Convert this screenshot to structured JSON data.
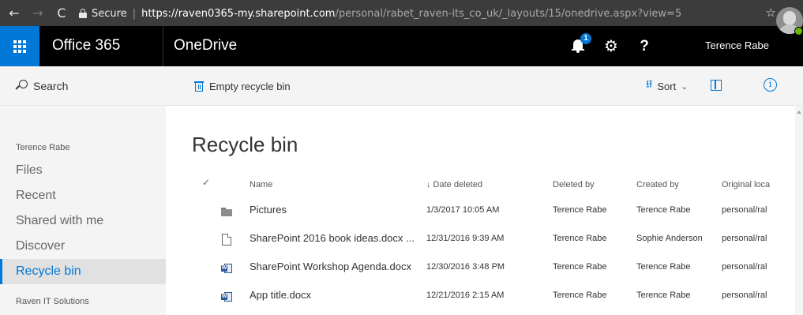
{
  "browser": {
    "back": "←",
    "forward": "→",
    "reload": "C",
    "secure_label": "Secure",
    "separator": "|",
    "url_scheme": "https://",
    "url_host": "raven0365-my.sharepoint.com",
    "url_path": "/personal/rabet_raven-its_co_uk/_layouts/15/onedrive.aspx?view=5",
    "bookmark": "☆",
    "menu": "⋮"
  },
  "suite": {
    "product": "Office 365",
    "app": "OneDrive",
    "notification_count": "1",
    "settings_glyph": "⚙",
    "help_glyph": "?",
    "user_name": "Terence Rabe"
  },
  "nav": {
    "search_label": "Search",
    "group_title": "Terence Rabe",
    "items": [
      {
        "label": "Files"
      },
      {
        "label": "Recent"
      },
      {
        "label": "Shared with me"
      },
      {
        "label": "Discover"
      },
      {
        "label": "Recycle bin",
        "selected": true
      }
    ],
    "group2_title": "Raven IT Solutions"
  },
  "commandbar": {
    "empty_bin_label": "Empty recycle bin",
    "sort_glyph": "⭿",
    "sort_label": "Sort",
    "sort_chevron": "⌄",
    "info_glyph": "i"
  },
  "main": {
    "title": "Recycle bin",
    "check_glyph": "✓",
    "columns": {
      "name": "Name",
      "date_deleted": "↓ Date deleted",
      "deleted_by": "Deleted by",
      "created_by": "Created by",
      "original_location": "Original loca"
    },
    "rows": [
      {
        "icon": "folder-icon",
        "name": "Pictures",
        "date_deleted": "1/3/2017 10:05 AM",
        "deleted_by": "Terence Rabe",
        "created_by": "Terence Rabe",
        "original_location": "personal/ral"
      },
      {
        "icon": "document-icon",
        "name": "SharePoint 2016 book ideas.docx ...",
        "date_deleted": "12/31/2016 9:39 AM",
        "deleted_by": "Terence Rabe",
        "created_by": "Sophie Anderson",
        "original_location": "personal/ral"
      },
      {
        "icon": "word-document-icon",
        "name": "SharePoint Workshop Agenda.docx",
        "date_deleted": "12/30/2016 3:48 PM",
        "deleted_by": "Terence Rabe",
        "created_by": "Terence Rabe",
        "original_location": "personal/ral"
      },
      {
        "icon": "word-document-icon",
        "name": "App title.docx",
        "date_deleted": "12/21/2016 2:15 AM",
        "deleted_by": "Terence Rabe",
        "created_by": "Terence Rabe",
        "original_location": "personal/ral"
      }
    ]
  },
  "colors": {
    "accent": "#0078d7",
    "suite_bar": "#000000",
    "browser_bar": "#3c3c3c",
    "nav_bg": "#f4f4f4",
    "word_blue": "#2b579a",
    "presence_green": "#6bb700"
  }
}
